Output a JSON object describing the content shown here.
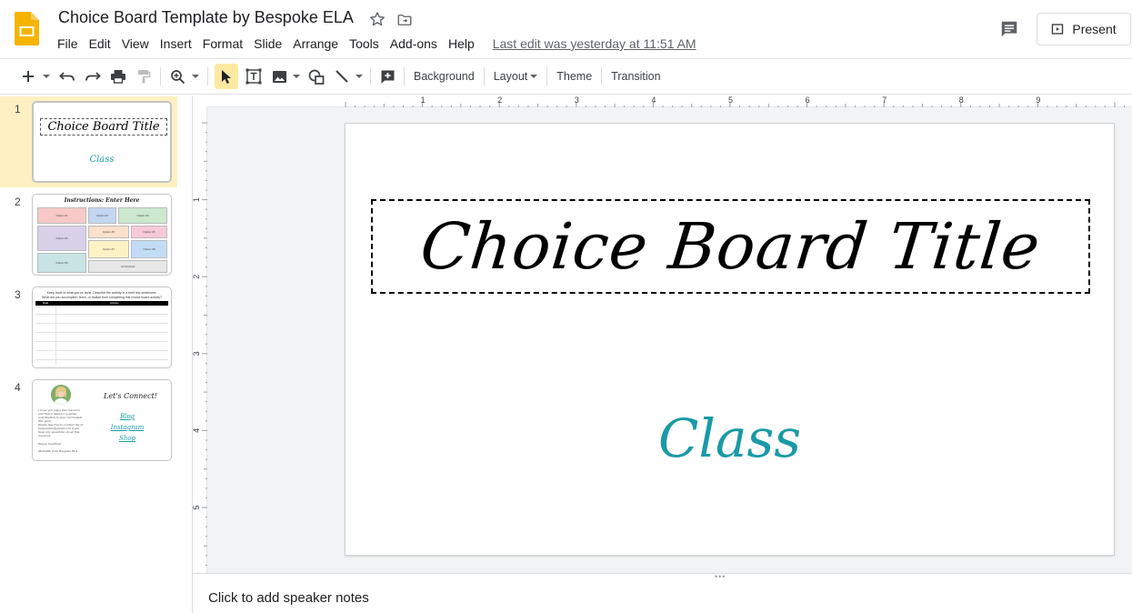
{
  "app": {
    "title": "Choice Board Template by Bespoke ELA",
    "last_edit": "Last edit was yesterday at 11:51 AM",
    "present_label": "Present",
    "accent": "#f4b400",
    "menu": [
      "File",
      "Edit",
      "View",
      "Insert",
      "Format",
      "Slide",
      "Arrange",
      "Tools",
      "Add-ons",
      "Help"
    ]
  },
  "toolbar": {
    "background_label": "Background",
    "layout_label": "Layout",
    "theme_label": "Theme",
    "transition_label": "Transition",
    "icons": [
      "add-icon",
      "undo-icon",
      "redo-icon",
      "print-icon",
      "paint-format-icon",
      "zoom-icon",
      "select-icon",
      "text-box-icon",
      "image-icon",
      "shape-icon",
      "line-icon",
      "add-comment-icon"
    ]
  },
  "ruler": {
    "top_labels": [
      "1",
      "2",
      "3",
      "4",
      "5",
      "6",
      "7",
      "8",
      "9"
    ],
    "left_labels": [
      "1",
      "2",
      "3",
      "4",
      "5"
    ]
  },
  "filmstrip": {
    "slides": [
      {
        "number": "1",
        "title": "Choice Board Title",
        "subtitle": "Class"
      },
      {
        "number": "2",
        "heading": "Instructions: Enter Here",
        "cells": [
          "Option #1",
          "Option #2",
          "Option #3",
          "Option #4",
          "Option #5",
          "Option #6",
          "Option #7",
          "Option #8",
          "Option #9",
          "All Finished"
        ]
      },
      {
        "number": "3",
        "line1": "Keep track of what you've done. Describe the activity in a brief few sentences.",
        "line2": "What did you accomplish, learn, or realize from completing this choice board activity?",
        "col1": "Date",
        "col2": "Activity"
      },
      {
        "number": "4",
        "heading": "Let's Connect!",
        "links": [
          "Blog",
          "Instagram",
          "Shop"
        ],
        "text1": "I hope you enjoy this resource and that it makes a positive contribution to your curriculum this year!",
        "text2": "Please feel free to contact me at bespokeela@gmail.com if you have any questions about this resource.",
        "text3": "Happy teaching!",
        "signoff": "Meredith from Bespoke ELA"
      }
    ]
  },
  "slide": {
    "title": "Choice Board Title",
    "subtitle": "Class",
    "subtitle_color": "#1a9aa6"
  },
  "notes": {
    "placeholder": "Click to add speaker notes"
  }
}
